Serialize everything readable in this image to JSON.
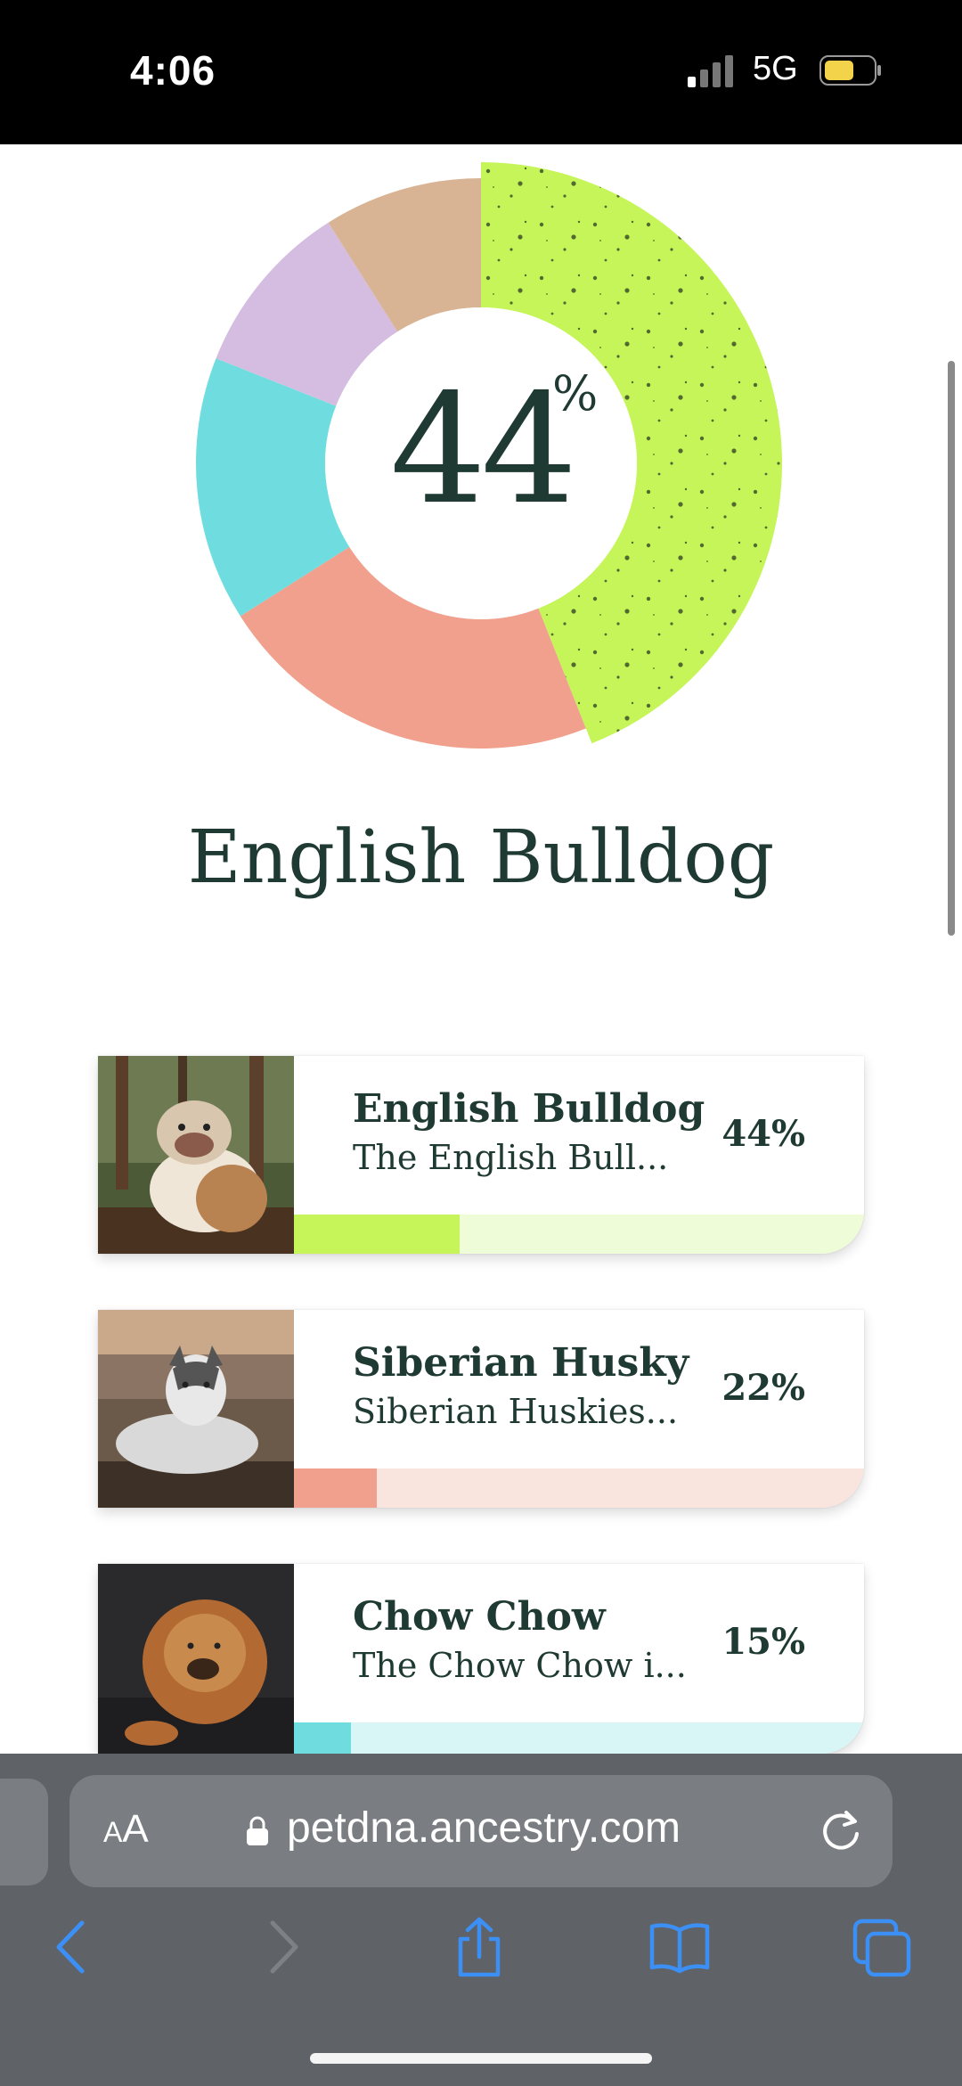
{
  "status_bar": {
    "time": "4:06",
    "network": "5G"
  },
  "donut": {
    "center_value": "44",
    "center_unit": "%",
    "segments": [
      {
        "label": "English Bulldog",
        "percent": 44,
        "color": "#c6f55a"
      },
      {
        "label": "Siberian Husky",
        "percent": 22,
        "color": "#f0a08c"
      },
      {
        "label": "Chow Chow",
        "percent": 15,
        "color": "#6fdde0"
      },
      {
        "label": "",
        "percent": 10,
        "color": "#d4bde0"
      },
      {
        "label": "",
        "percent": 9,
        "color": "#d8b494"
      }
    ]
  },
  "heading": "English Bulldog",
  "breeds": [
    {
      "name": "English Bulldog",
      "desc": "The English Bull...",
      "pct": "44%",
      "fill": 0.29,
      "color": "#c6f55a",
      "track": "#eefcd8"
    },
    {
      "name": "Siberian Husky",
      "desc": "Siberian Huskies...",
      "pct": "22%",
      "fill": 0.145,
      "color": "#f0a08c",
      "track": "#f9e5de"
    },
    {
      "name": "Chow Chow",
      "desc": "The Chow Chow i...",
      "pct": "15%",
      "fill": 0.1,
      "color": "#6fdde0",
      "track": "#d9f6f7"
    }
  ],
  "browser": {
    "text_size_label": "AA",
    "url": "petdna.ancestry.com"
  },
  "colors": {
    "text": "#1f3a32",
    "safari_blue": "#3b8ff5"
  }
}
